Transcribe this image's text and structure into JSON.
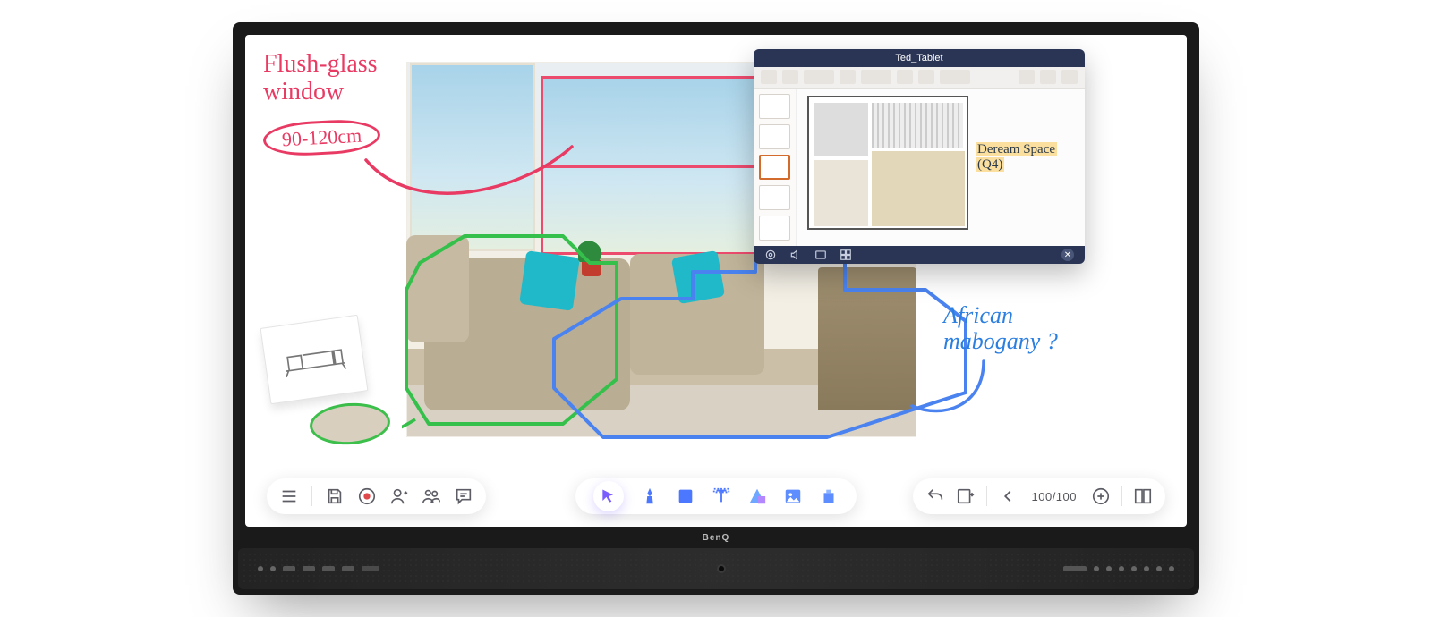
{
  "brand": "BenQ",
  "annotations": {
    "red": {
      "title": "Flush-glass",
      "title2": "window",
      "measurement": "90-120cm"
    },
    "blue": {
      "line1": "African",
      "line2": "mabogany ?"
    },
    "slide_note": {
      "line1": "Deream Space",
      "line2": "(Q4)"
    }
  },
  "tablet_window": {
    "title": "Ted_Tablet"
  },
  "toolbar": {
    "left": {
      "menu": "menu",
      "save": "save",
      "record": "record",
      "add_user": "add-user",
      "group": "group",
      "comment": "comment"
    },
    "center": {
      "select": "select",
      "pen": "pen",
      "shape": "square",
      "text": "text",
      "geometry": "triangle",
      "image": "image",
      "widgets": "widgets"
    },
    "right": {
      "undo": "undo",
      "export": "export",
      "prev": "previous-page",
      "page_counter": "100/100",
      "next": "add-page",
      "library": "library"
    }
  }
}
